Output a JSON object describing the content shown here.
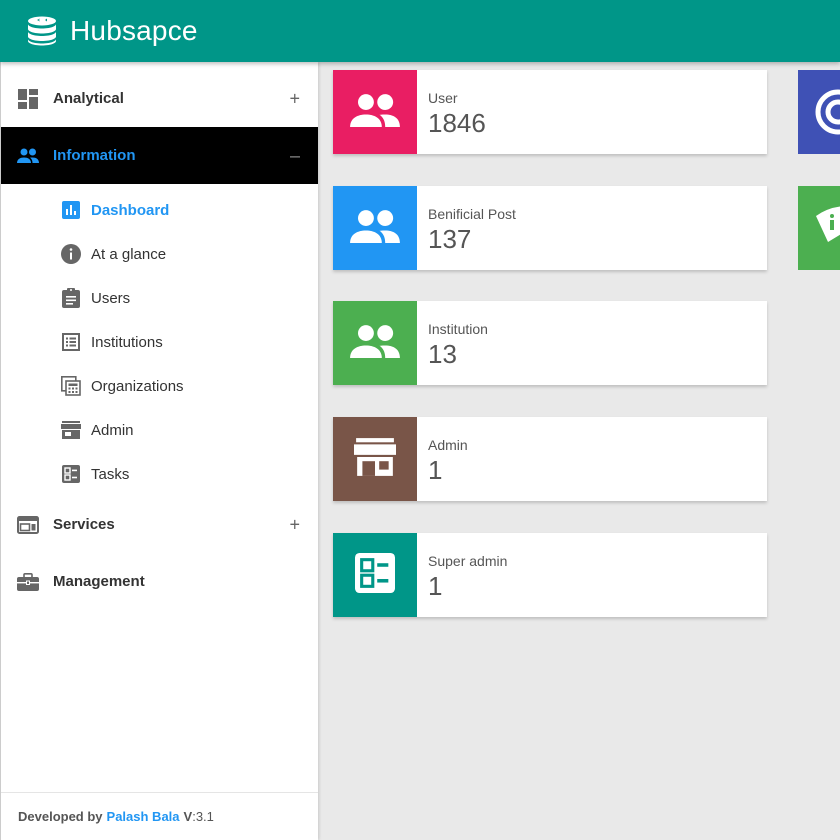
{
  "app": {
    "brand": "Hubsapce"
  },
  "sidebar": {
    "groups": [
      {
        "label": "Analytical",
        "toggle": "+",
        "icon": "dashboard-grid-icon"
      },
      {
        "label": "Information",
        "toggle": "–",
        "icon": "people-icon"
      },
      {
        "label": "Services",
        "toggle": "+",
        "icon": "web-window-icon"
      },
      {
        "label": "Management",
        "toggle": "",
        "icon": "briefcase-icon"
      }
    ],
    "sub_items": [
      {
        "label": "Dashboard",
        "icon": "bar-chart-icon"
      },
      {
        "label": "At a glance",
        "icon": "info-icon"
      },
      {
        "label": "Users",
        "icon": "clipboard-icon"
      },
      {
        "label": "Institutions",
        "icon": "list-box-icon"
      },
      {
        "label": "Organizations",
        "icon": "calculator-icon"
      },
      {
        "label": "Admin",
        "icon": "store-icon"
      },
      {
        "label": "Tasks",
        "icon": "checklist-icon"
      }
    ]
  },
  "footer": {
    "developed_by": "Developed by",
    "author": "Palash Bala",
    "version_label": "V",
    "version": ":3.1"
  },
  "stats": [
    {
      "label": "User",
      "value": "1846",
      "color": "#e91e63",
      "icon": "people-icon"
    },
    {
      "label": "Benificial Post",
      "value": "137",
      "color": "#2196f3",
      "icon": "people-icon"
    },
    {
      "label": "Institution",
      "value": "13",
      "color": "#4caf50",
      "icon": "people-icon"
    },
    {
      "label": "Admin",
      "value": "1",
      "color": "#795548",
      "icon": "store-icon"
    },
    {
      "label": "Super admin",
      "value": "1",
      "color": "#009688",
      "icon": "checklist-icon"
    }
  ],
  "edge_cards": [
    {
      "color": "#3f51b5",
      "icon": "target-icon"
    },
    {
      "color": "#4caf50",
      "icon": "wifi-icon"
    }
  ]
}
